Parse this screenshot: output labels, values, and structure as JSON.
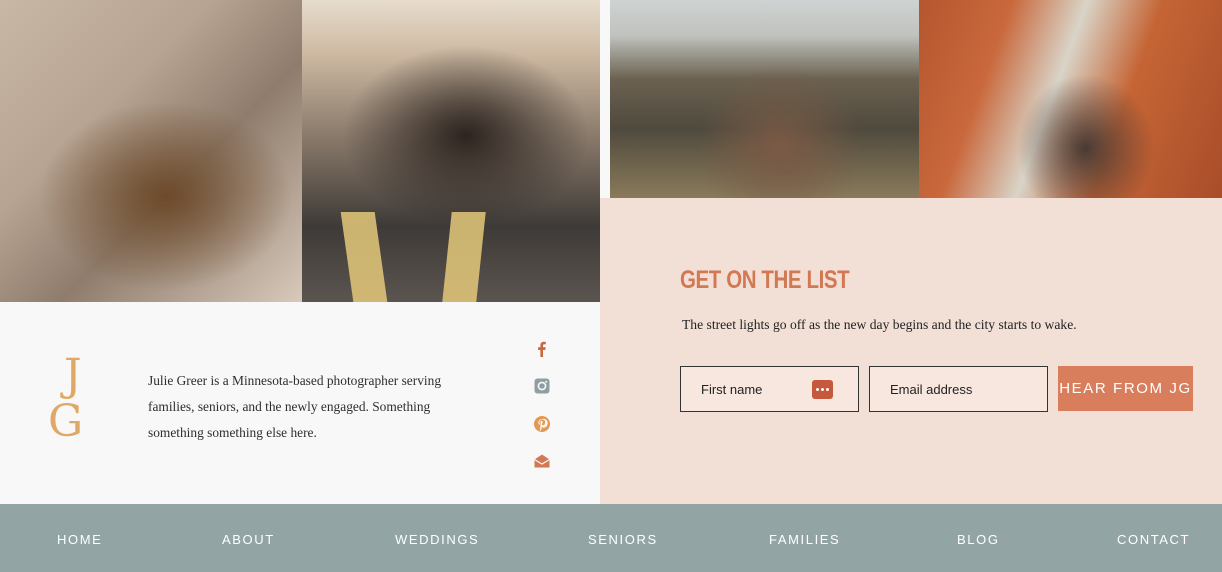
{
  "photos": [
    {
      "name": "couple-on-rocks"
    },
    {
      "name": "couple-on-road"
    },
    {
      "name": "couple-on-hillside"
    },
    {
      "name": "couple-red-rocks"
    }
  ],
  "about": {
    "monogram_top": "J",
    "monogram_bottom": "G",
    "bio": "Julie Greer is a Minnesota-based photographer serving families, seniors, and the newly engaged. Something something something else here."
  },
  "social": {
    "icons": [
      "facebook-icon",
      "instagram-icon",
      "pinterest-icon",
      "mail-icon"
    ],
    "colors": {
      "facebook": "#c8683f",
      "instagram": "#8f9ea2",
      "pinterest": "#e29a52",
      "mail": "#d27853"
    }
  },
  "newsletter": {
    "title": "GET ON THE LIST",
    "subtitle": "The street lights go off as the new day begins and the city starts to wake.",
    "first_name_placeholder": "First name",
    "email_placeholder": "Email address",
    "submit_label": "HEAR FROM JG"
  },
  "nav": {
    "items": [
      "HOME",
      "ABOUT",
      "WEDDINGS",
      "SENIORS",
      "FAMILIES",
      "BLOG",
      "CONTACT"
    ]
  },
  "colors": {
    "accent": "#d27853",
    "button": "#d87e5c",
    "nav_bg": "#93a4a5",
    "newsletter_bg": "#f2e0d6",
    "monogram": "#e0a866"
  }
}
